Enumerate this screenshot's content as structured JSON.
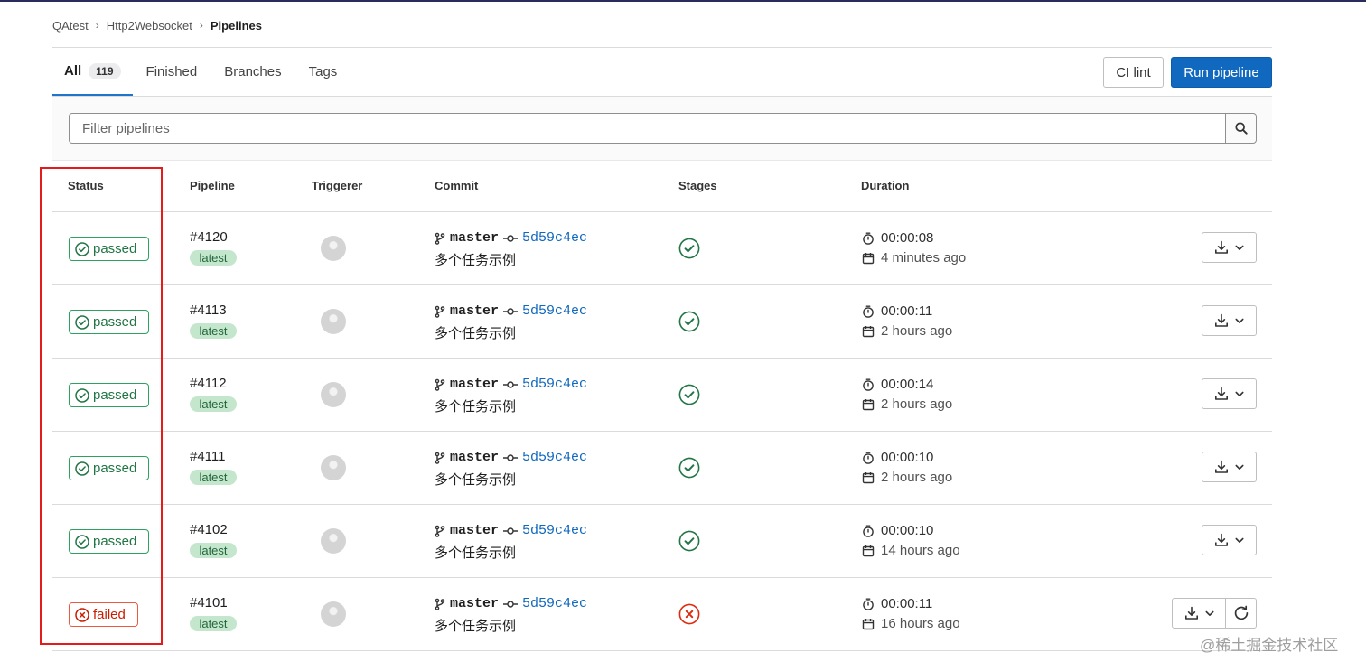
{
  "breadcrumb": {
    "items": [
      "QAtest",
      "Http2Websocket"
    ],
    "current": "Pipelines"
  },
  "tabs": [
    {
      "label": "All",
      "count": "119",
      "active": true
    },
    {
      "label": "Finished"
    },
    {
      "label": "Branches"
    },
    {
      "label": "Tags"
    }
  ],
  "actions": {
    "ci_lint": "CI lint",
    "run_pipeline": "Run pipeline"
  },
  "filter": {
    "placeholder": "Filter pipelines"
  },
  "table": {
    "headers": {
      "status": "Status",
      "pipeline": "Pipeline",
      "triggerer": "Triggerer",
      "commit": "Commit",
      "stages": "Stages",
      "duration": "Duration"
    },
    "rows": [
      {
        "status": "passed",
        "id": "#4120",
        "tag": "latest",
        "branch": "master",
        "sha": "5d59c4ec",
        "message": "多个任务示例",
        "stage_status": "success",
        "duration": "00:00:08",
        "finished": "4 minutes ago"
      },
      {
        "status": "passed",
        "id": "#4113",
        "tag": "latest",
        "branch": "master",
        "sha": "5d59c4ec",
        "message": "多个任务示例",
        "stage_status": "success",
        "duration": "00:00:11",
        "finished": "2 hours ago"
      },
      {
        "status": "passed",
        "id": "#4112",
        "tag": "latest",
        "branch": "master",
        "sha": "5d59c4ec",
        "message": "多个任务示例",
        "stage_status": "success",
        "duration": "00:00:14",
        "finished": "2 hours ago"
      },
      {
        "status": "passed",
        "id": "#4111",
        "tag": "latest",
        "branch": "master",
        "sha": "5d59c4ec",
        "message": "多个任务示例",
        "stage_status": "success",
        "duration": "00:00:10",
        "finished": "2 hours ago"
      },
      {
        "status": "passed",
        "id": "#4102",
        "tag": "latest",
        "branch": "master",
        "sha": "5d59c4ec",
        "message": "多个任务示例",
        "stage_status": "success",
        "duration": "00:00:10",
        "finished": "14 hours ago"
      },
      {
        "status": "failed",
        "id": "#4101",
        "tag": "latest",
        "branch": "master",
        "sha": "5d59c4ec",
        "message": "多个任务示例",
        "stage_status": "failed",
        "duration": "00:00:11",
        "finished": "16 hours ago",
        "retry": true
      }
    ]
  },
  "colors": {
    "passed": "#217645",
    "failed": "#c91c00",
    "primary": "#1068bf",
    "annotation": "#e31b1b"
  },
  "icons": {
    "search": "search-icon",
    "branch": "branch-icon",
    "commit": "commit-icon",
    "timer": "timer-icon",
    "calendar": "calendar-icon",
    "download": "download-icon",
    "chevron": "chevron-down-icon",
    "retry": "retry-icon"
  },
  "watermark": "@稀土掘金技术社区"
}
